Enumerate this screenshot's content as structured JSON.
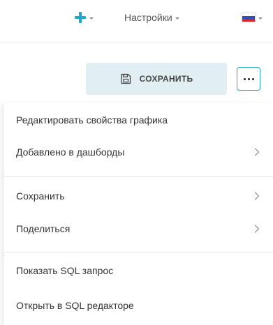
{
  "navbar": {
    "add_icon": "plus-icon",
    "settings_label": "Настройки",
    "language_flag": "russia-flag-icon",
    "flag_colors": [
      "#ffffff",
      "#2f4fb8",
      "#d7262e"
    ],
    "accent_color": "#20a7c9"
  },
  "toolbar": {
    "save_icon": "floppy-disk-icon",
    "save_label": "СОХРАНИТЬ",
    "more_icon": "ellipsis-icon"
  },
  "menu": {
    "items": [
      {
        "label": "Редактировать свойства графика",
        "has_submenu": false
      },
      {
        "label": "Добавлено в дашборды",
        "has_submenu": true
      },
      {
        "label": "Сохранить",
        "has_submenu": true
      },
      {
        "label": "Поделиться",
        "has_submenu": true
      },
      {
        "label": "Показать SQL запрос",
        "has_submenu": false
      },
      {
        "label": "Открыть в SQL редакторе",
        "has_submenu": false
      }
    ],
    "chevron_icon": "chevron-right-icon"
  }
}
